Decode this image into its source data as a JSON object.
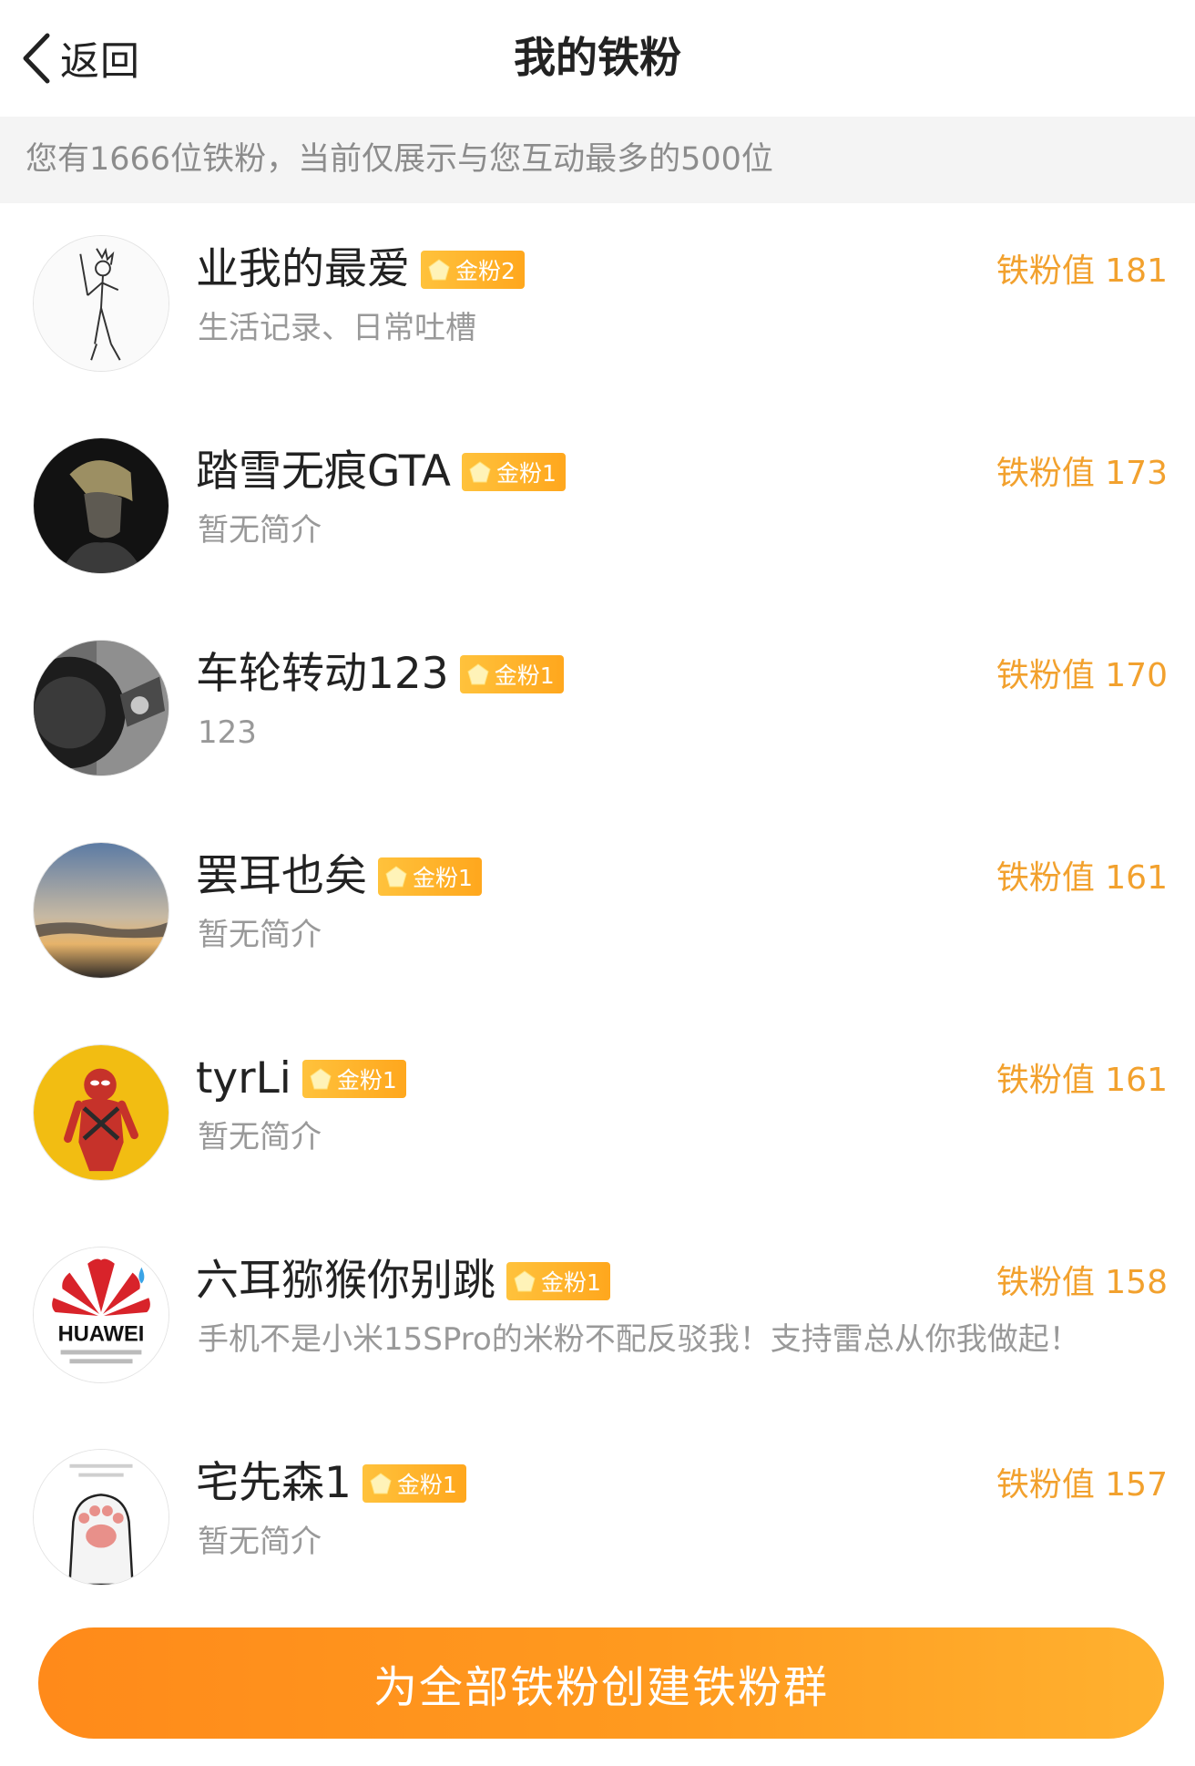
{
  "header": {
    "back_label": "返回",
    "title": "我的铁粉"
  },
  "notice": "您有1666位铁粉，当前仅展示与您互动最多的500位",
  "fans": [
    {
      "name": "业我的最爱",
      "badge": "金粉2",
      "bio": "生活记录、日常吐槽",
      "score": "铁粉值 181",
      "avatar_icon": "sketch-character-avatar"
    },
    {
      "name": "踏雪无痕GTA",
      "badge": "金粉1",
      "bio": "暂无简介",
      "score": "铁粉值 173",
      "avatar_icon": "anime-character-avatar"
    },
    {
      "name": "车轮转动123",
      "badge": "金粉1",
      "bio": "123",
      "score": "铁粉值 170",
      "avatar_icon": "car-wheel-avatar"
    },
    {
      "name": "罢耳也矣",
      "badge": "金粉1",
      "bio": "暂无简介",
      "score": "铁粉值 161",
      "avatar_icon": "sunset-sky-avatar"
    },
    {
      "name": "tyrLi",
      "badge": "金粉1",
      "bio": "暂无简介",
      "score": "铁粉值 161",
      "avatar_icon": "deadpool-avatar"
    },
    {
      "name": "六耳猕猴你别跳",
      "badge": "金粉1",
      "bio": "手机不是小米15SPro的米粉不配反驳我！支持雷总从你我做起！",
      "score": "铁粉值 158",
      "avatar_icon": "huawei-logo-avatar",
      "avatar_text": "HUAWEI"
    },
    {
      "name": "宅先森1",
      "badge": "金粉1",
      "bio": "暂无简介",
      "score": "铁粉值 157",
      "avatar_icon": "cat-paw-avatar"
    }
  ],
  "bottom": {
    "button_label": "为全部铁粉创建铁粉群"
  },
  "colors": {
    "accent": "#f2a12e",
    "button_start": "#ff8a1a",
    "button_end": "#ffb12f",
    "badge": "#ffb22a"
  }
}
